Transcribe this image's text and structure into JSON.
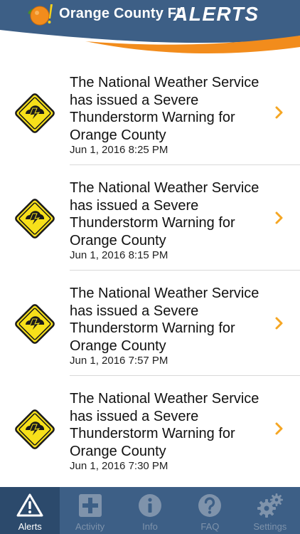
{
  "header": {
    "title_main": "Orange County FL",
    "title_alerts": "ALERTS"
  },
  "colors": {
    "header_blue": "#3d5f86",
    "header_orange": "#f28c1c",
    "tabbar_blue": "#3d5f86",
    "chevron_orange": "#f5a623",
    "warning_yellow": "#f7e01a"
  },
  "alerts": [
    {
      "text": "The National Weather Service has issued a Severe Thunderstorm Warning for Orange County",
      "date": "Jun 1, 2016 8:25 PM",
      "icon": "thunderstorm-warning-icon"
    },
    {
      "text": "The National Weather Service has issued a Severe Thunderstorm Warning for Orange County",
      "date": "Jun 1, 2016 8:15 PM",
      "icon": "thunderstorm-warning-icon"
    },
    {
      "text": "The National Weather Service has issued a Severe Thunderstorm Warning for Orange County",
      "date": "Jun 1, 2016 7:57 PM",
      "icon": "thunderstorm-warning-icon"
    },
    {
      "text": "The National Weather Service has issued a Severe Thunderstorm Warning for Orange County",
      "date": "Jun 1, 2016 7:30 PM",
      "icon": "thunderstorm-warning-icon"
    }
  ],
  "tabs": [
    {
      "label": "Alerts",
      "icon": "warning-triangle-icon",
      "active": true
    },
    {
      "label": "Activity",
      "icon": "plus-icon",
      "active": false
    },
    {
      "label": "Info",
      "icon": "info-icon",
      "active": false
    },
    {
      "label": "FAQ",
      "icon": "question-icon",
      "active": false
    },
    {
      "label": "Settings",
      "icon": "gear-icon",
      "active": false
    }
  ]
}
